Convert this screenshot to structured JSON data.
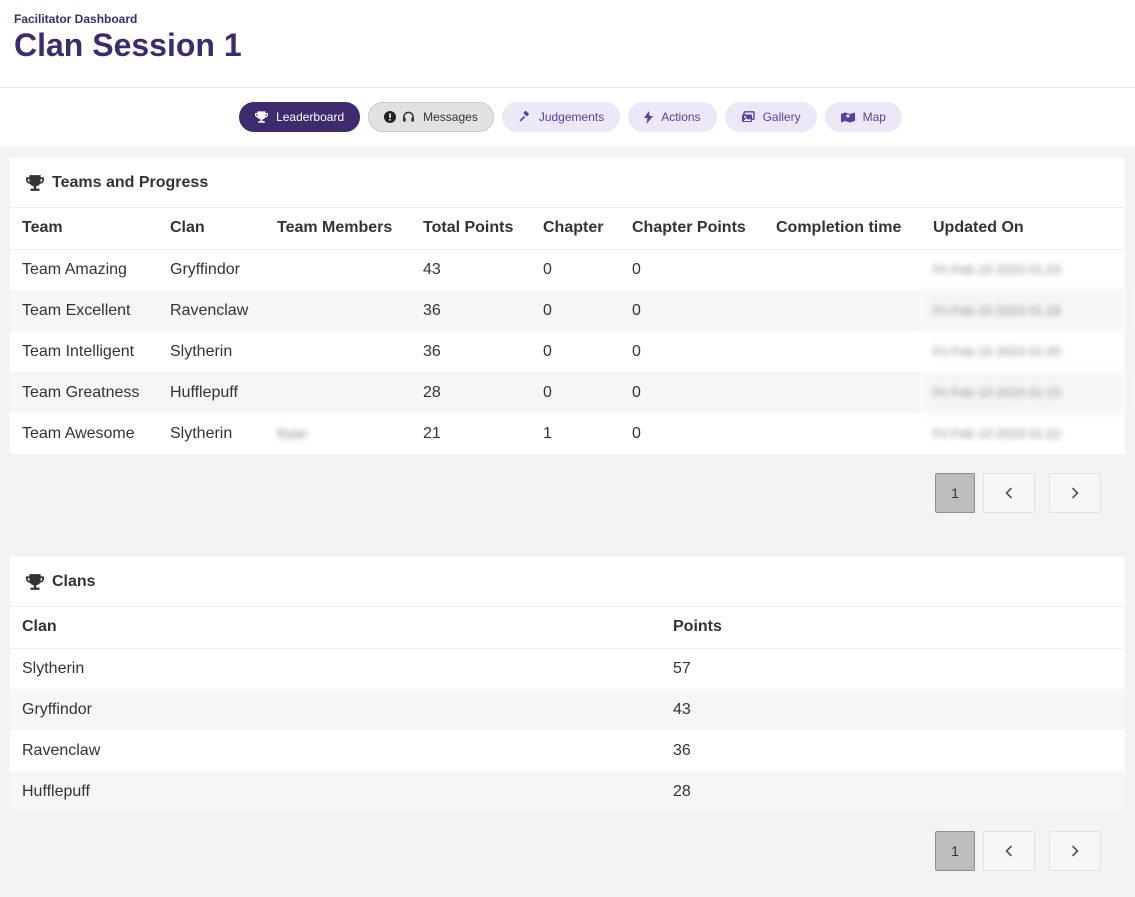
{
  "header": {
    "subtitle": "Facilitator Dashboard",
    "title": "Clan Session 1"
  },
  "nav": {
    "leaderboard": "Leaderboard",
    "messages": "Messages",
    "judgements": "Judgements",
    "actions": "Actions",
    "gallery": "Gallery",
    "map": "Map"
  },
  "teams": {
    "title": "Teams and Progress",
    "columns": [
      "Team",
      "Clan",
      "Team Members",
      "Total Points",
      "Chapter",
      "Chapter Points",
      "Completion time",
      "Updated On"
    ],
    "rows": [
      {
        "team": "Team Amazing",
        "clan": "Gryffindor",
        "members": "",
        "total": "43",
        "chapter": "0",
        "chapter_points": "0",
        "completion": "",
        "updated": "Fri Feb 10 2023 01:23"
      },
      {
        "team": "Team Excellent",
        "clan": "Ravenclaw",
        "members": "",
        "total": "36",
        "chapter": "0",
        "chapter_points": "0",
        "completion": "",
        "updated": "Fri Feb 10 2023 01:18"
      },
      {
        "team": "Team Intelligent",
        "clan": "Slytherin",
        "members": "",
        "total": "36",
        "chapter": "0",
        "chapter_points": "0",
        "completion": "",
        "updated": "Fri Feb 10 2023 01:20"
      },
      {
        "team": "Team Greatness",
        "clan": "Hufflepuff",
        "members": "",
        "total": "28",
        "chapter": "0",
        "chapter_points": "0",
        "completion": "",
        "updated": "Fri Feb 10 2023 01:15"
      },
      {
        "team": "Team Awesome",
        "clan": "Slytherin",
        "members": "Ryan",
        "total": "21",
        "chapter": "1",
        "chapter_points": "0",
        "completion": "",
        "updated": "Fri Feb 10 2023 01:22"
      }
    ],
    "page": "1"
  },
  "clans": {
    "title": "Clans",
    "columns": [
      "Clan",
      "Points"
    ],
    "rows": [
      {
        "clan": "Slytherin",
        "points": "57"
      },
      {
        "clan": "Gryffindor",
        "points": "43"
      },
      {
        "clan": "Ravenclaw",
        "points": "36"
      },
      {
        "clan": "Hufflepuff",
        "points": "28"
      }
    ],
    "page": "1"
  }
}
